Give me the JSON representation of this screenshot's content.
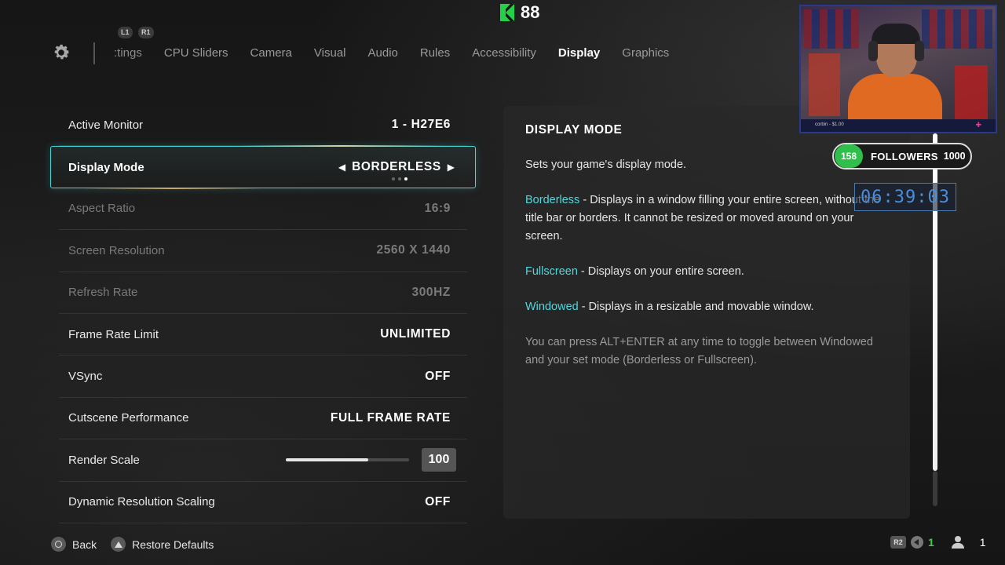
{
  "top": {
    "coin_count": "88"
  },
  "tab_bar": {
    "shoulder_left": "L1",
    "shoulder_right": "R1",
    "tabs": [
      {
        "label": ":tings",
        "state": "partial"
      },
      {
        "label": "CPU Sliders",
        "state": "inactive"
      },
      {
        "label": "Camera",
        "state": "inactive"
      },
      {
        "label": "Visual",
        "state": "inactive"
      },
      {
        "label": "Audio",
        "state": "inactive"
      },
      {
        "label": "Rules",
        "state": "inactive"
      },
      {
        "label": "Accessibility",
        "state": "inactive"
      },
      {
        "label": "Display",
        "state": "active"
      },
      {
        "label": "Graphics",
        "state": "inactive"
      }
    ]
  },
  "settings": {
    "active_monitor": {
      "label": "Active Monitor",
      "value": "1 - H27E6"
    },
    "display_mode": {
      "label": "Display Mode",
      "value": "BORDERLESS",
      "option_count": 3,
      "selected_index": 2
    },
    "aspect_ratio": {
      "label": "Aspect Ratio",
      "value": "16:9"
    },
    "screen_resolution": {
      "label": "Screen Resolution",
      "value": "2560 X 1440"
    },
    "refresh_rate": {
      "label": "Refresh Rate",
      "value": "300HZ"
    },
    "frame_rate_limit": {
      "label": "Frame Rate Limit",
      "value": "UNLIMITED"
    },
    "vsync": {
      "label": "VSync",
      "value": "OFF"
    },
    "cutscene_performance": {
      "label": "Cutscene Performance",
      "value": "FULL FRAME RATE"
    },
    "render_scale": {
      "label": "Render Scale",
      "value": "100",
      "fill_fraction": 0.67
    },
    "dynamic_resolution": {
      "label": "Dynamic Resolution Scaling",
      "value": "OFF"
    }
  },
  "description": {
    "title": "DISPLAY MODE",
    "intro": "Sets your game's display mode.",
    "borderless_term": "Borderless",
    "borderless_text": " - Displays in a window filling your entire screen, without the title bar or borders. It cannot be resized or moved around on your screen.",
    "fullscreen_term": "Fullscreen",
    "fullscreen_text": " - Displays on your entire screen.",
    "windowed_term": "Windowed",
    "windowed_text": " - Displays in a resizable and movable window.",
    "note": "You can press ALT+ENTER at any time to toggle between Windowed and your set mode (Borderless or Fullscreen)."
  },
  "overlay": {
    "cam_bar_text": "corbin - $1.00",
    "followers_count": "158",
    "followers_label": "FOLLOWERS",
    "followers_goal": "1000",
    "timer": "06:39:03"
  },
  "footer": {
    "back_label": "Back",
    "restore_label": "Restore Defaults",
    "r2_label": "R2",
    "green_count": "1",
    "party_count": "1"
  },
  "colors": {
    "accent": "#46d6d6",
    "highlight_term": "#4fd8de",
    "follower_badge": "#2fbf4a",
    "coin": "#22d04a"
  }
}
